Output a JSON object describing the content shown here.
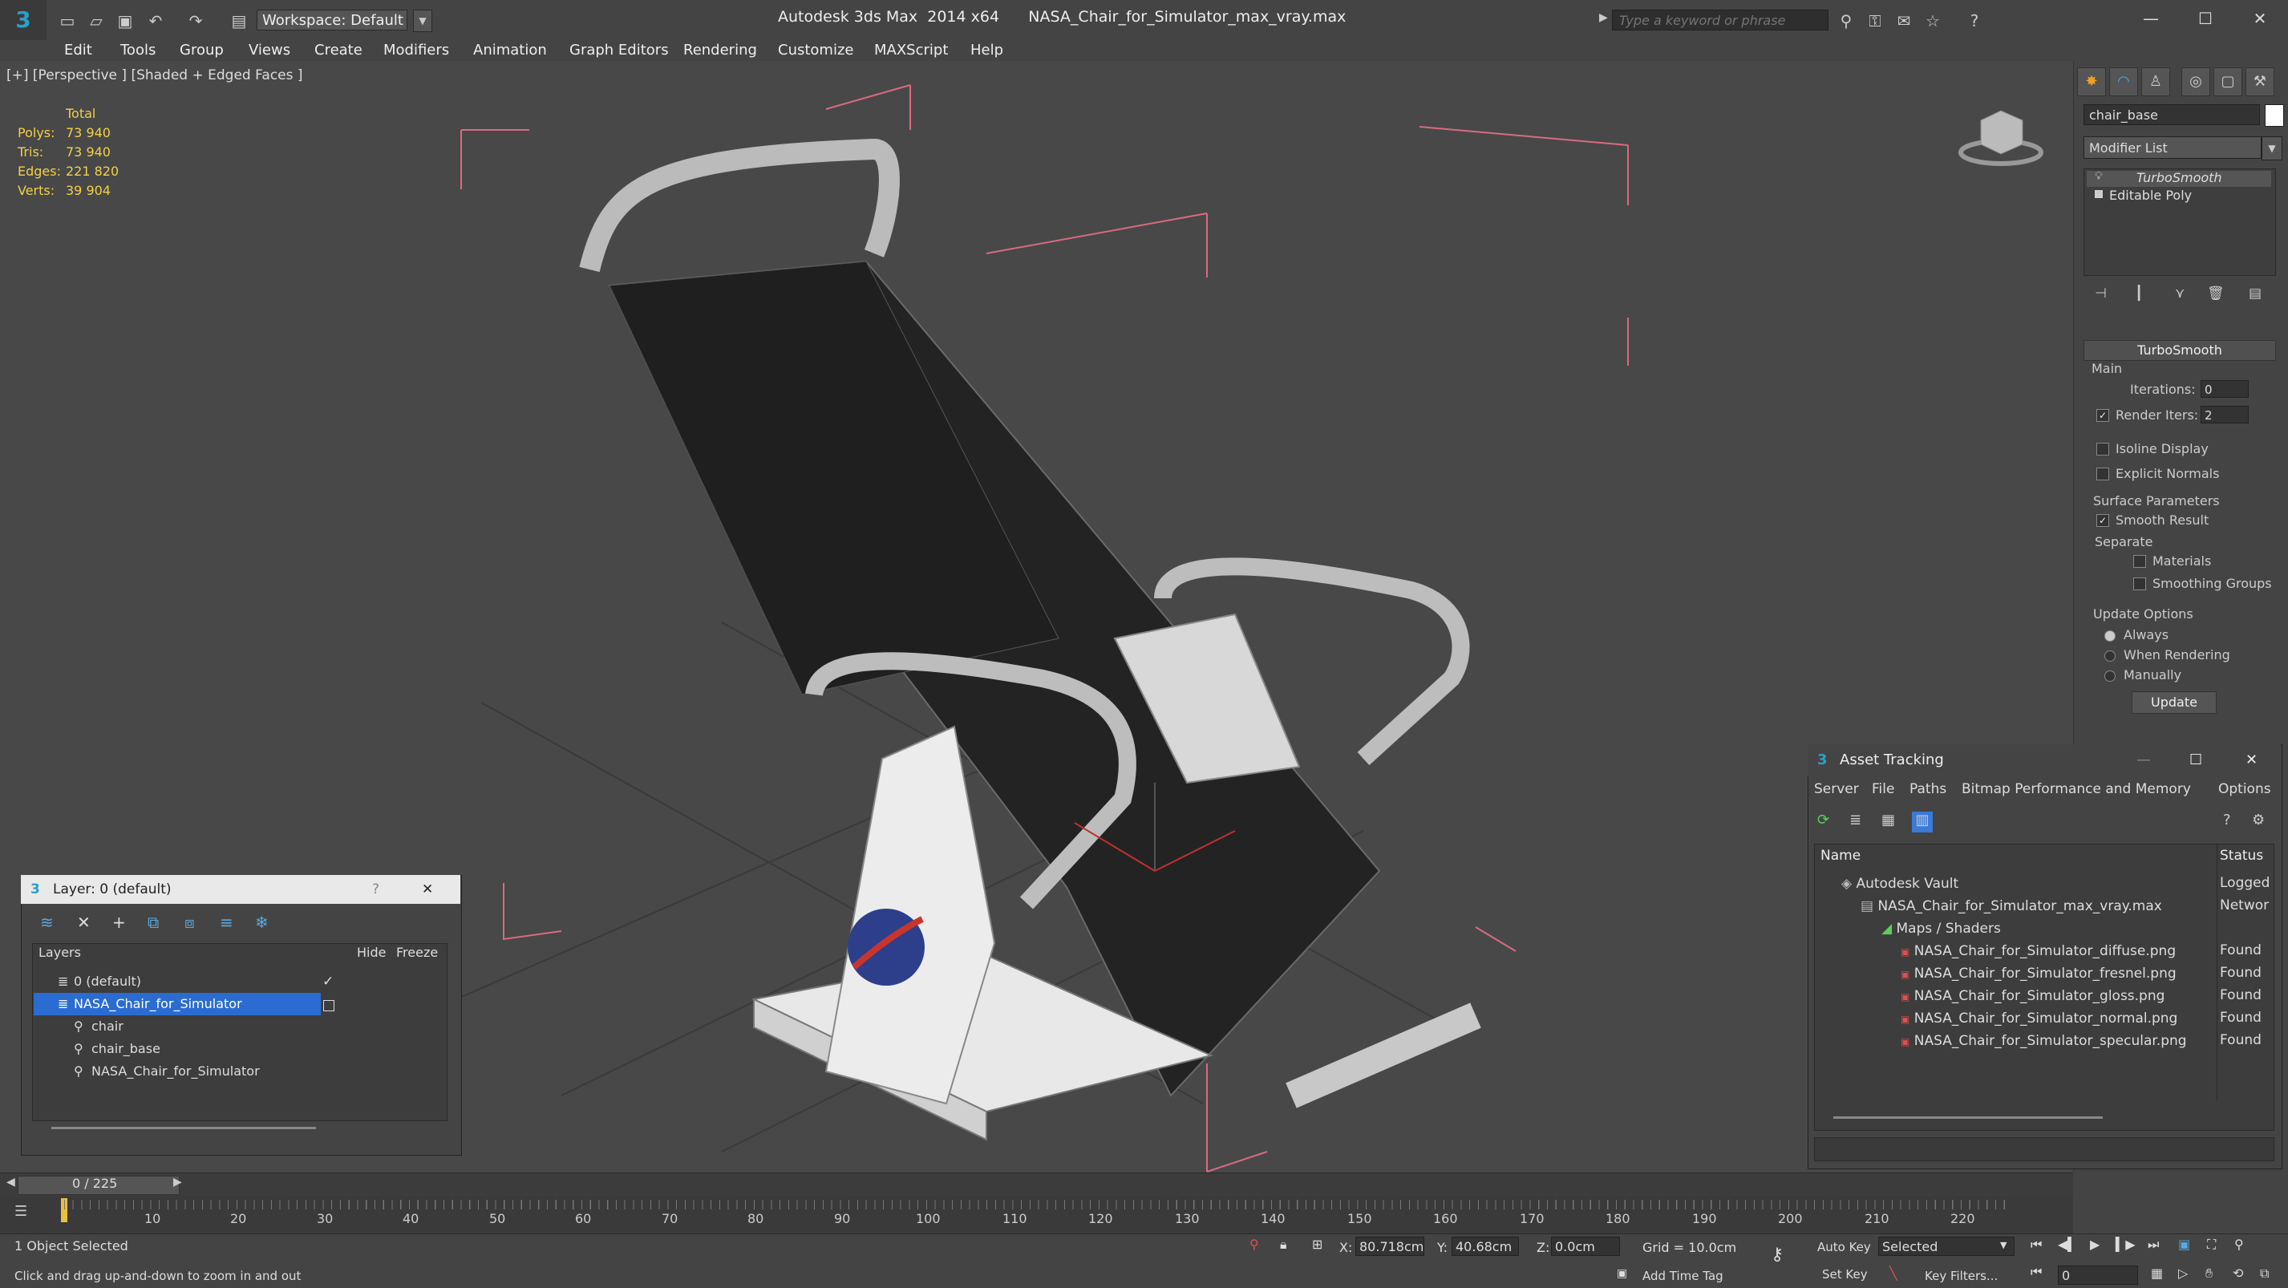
{
  "app": {
    "title": "Autodesk 3ds Max  2014 x64      NASA_Chair_for_Simulator_max_vray.max",
    "workspace": "Workspace: Default",
    "search_placeholder": "Type a keyword or phrase"
  },
  "menu": [
    "Edit",
    "Tools",
    "Group",
    "Views",
    "Create",
    "Modifiers",
    "Animation",
    "Graph Editors",
    "Rendering",
    "Customize",
    "MAXScript",
    "Help"
  ],
  "viewport": {
    "label": "[+] [Perspective ] [Shaded + Edged Faces ]",
    "stats": {
      "header": "Total",
      "rows": [
        {
          "label": "Polys:",
          "value": "73 940"
        },
        {
          "label": "Tris:",
          "value": "73 940"
        },
        {
          "label": "Edges:",
          "value": "221 820"
        },
        {
          "label": "Verts:",
          "value": "39 904"
        }
      ]
    }
  },
  "command_panel": {
    "object_name": "chair_base",
    "modifier_list": "Modifier List",
    "stack": [
      "TurboSmooth",
      "Editable Poly"
    ],
    "rollout_title": "TurboSmooth",
    "main_label": "Main",
    "iterations_label": "Iterations:",
    "iterations_value": "0",
    "render_iters_label": "Render Iters:",
    "render_iters_value": "2",
    "isoline_display": "Isoline Display",
    "explicit_normals": "Explicit Normals",
    "surface_parameters": "Surface Parameters",
    "smooth_result": "Smooth Result",
    "separate": "Separate",
    "materials": "Materials",
    "smoothing_groups": "Smoothing Groups",
    "update_options": "Update Options",
    "always": "Always",
    "when_rendering": "When Rendering",
    "manually": "Manually",
    "update_button": "Update"
  },
  "layer_window": {
    "title": "Layer: 0 (default)",
    "help": "?",
    "columns": {
      "layers": "Layers",
      "hide": "Hide",
      "freeze": "Freeze"
    },
    "rows": [
      "0 (default)",
      "NASA_Chair_for_Simulator",
      "chair",
      "chair_base",
      "NASA_Chair_for_Simulator"
    ]
  },
  "asset_tracking": {
    "title": "Asset Tracking",
    "menu": [
      "Server",
      "File",
      "Paths",
      "Bitmap Performance and Memory",
      "Options"
    ],
    "columns": {
      "name": "Name",
      "status": "Status"
    },
    "rows": [
      {
        "name": "Autodesk Vault",
        "status": "Logged"
      },
      {
        "name": "NASA_Chair_for_Simulator_max_vray.max",
        "status": "Networ"
      },
      {
        "name": "Maps / Shaders",
        "status": ""
      },
      {
        "name": "NASA_Chair_for_Simulator_diffuse.png",
        "status": "Found"
      },
      {
        "name": "NASA_Chair_for_Simulator_fresnel.png",
        "status": "Found"
      },
      {
        "name": "NASA_Chair_for_Simulator_gloss.png",
        "status": "Found"
      },
      {
        "name": "NASA_Chair_for_Simulator_normal.png",
        "status": "Found"
      },
      {
        "name": "NASA_Chair_for_Simulator_specular.png",
        "status": "Found"
      }
    ]
  },
  "timeline": {
    "frame": "0 / 225",
    "ticks": [
      "10",
      "20",
      "30",
      "40",
      "50",
      "60",
      "70",
      "80",
      "90",
      "100",
      "110",
      "120",
      "130",
      "140",
      "150",
      "160",
      "170",
      "180",
      "190",
      "200",
      "210",
      "220"
    ]
  },
  "status": {
    "selected": "1 Object Selected",
    "prompt": "Click and drag up-and-down to zoom in and out",
    "x_label": "X:",
    "x_value": "80.718cm",
    "y_label": "Y:",
    "y_value": "40.68cm",
    "z_label": "Z:",
    "z_value": "0.0cm",
    "grid": "Grid = 10.0cm",
    "add_time_tag": "Add Time Tag",
    "auto_key": "Auto Key",
    "set_key": "Set Key",
    "selected_dropdown": "Selected",
    "key_filters": "Key Filters...",
    "frame_field": "0"
  }
}
